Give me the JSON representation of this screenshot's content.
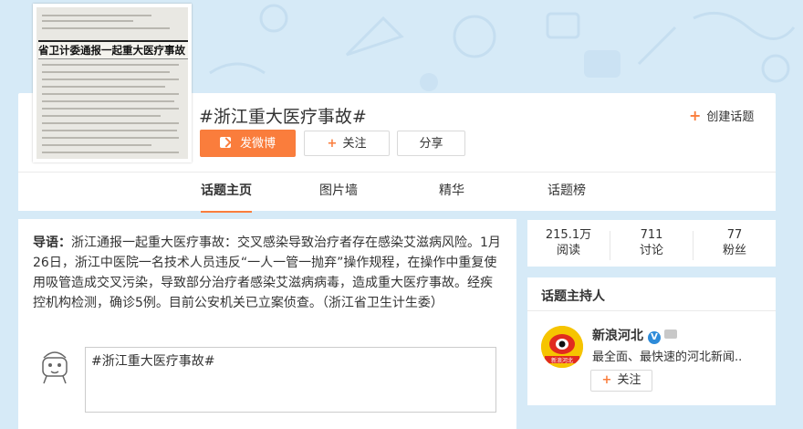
{
  "topic": {
    "title": "#浙江重大医疗事故#",
    "cover_headline": "省卫计委通报一起重大医疗事故"
  },
  "header": {
    "create_topic_label": "创建话题",
    "post_button_label": "发微博",
    "follow_button_label": "关注",
    "share_button_label": "分享"
  },
  "tabs": [
    {
      "label": "话题主页",
      "active": true
    },
    {
      "label": "图片墙",
      "active": false
    },
    {
      "label": "精华",
      "active": false
    },
    {
      "label": "话题榜",
      "active": false
    }
  ],
  "intro": {
    "prefix": "导语：",
    "text": "浙江通报一起重大医疗事故：交叉感染导致治疗者存在感染艾滋病风险。1月26日，浙江中医院一名技术人员违反“一人一管一抛弃”操作规程，在操作中重复使用吸管造成交叉污染，导致部分治疗者感染艾滋病病毒，造成重大医疗事故。经疾控机构检测，确诊5例。目前公安机关已立案侦查。（浙江省卫生计生委）"
  },
  "composer": {
    "value": "#浙江重大医疗事故#"
  },
  "stats": [
    {
      "value": "215.1万",
      "label": "阅读"
    },
    {
      "value": "711",
      "label": "讨论"
    },
    {
      "value": "77",
      "label": "粉丝"
    }
  ],
  "host": {
    "section_title": "话题主持人",
    "name": "新浪河北",
    "description": "最全面、最快速的河北新闻..",
    "follow_label": "关注",
    "avatar_text": "新浪河北"
  },
  "colors": {
    "accent": "#fa7d3c",
    "page_bg": "#d6eaf7",
    "verified_blue": "#2d8bd9"
  }
}
